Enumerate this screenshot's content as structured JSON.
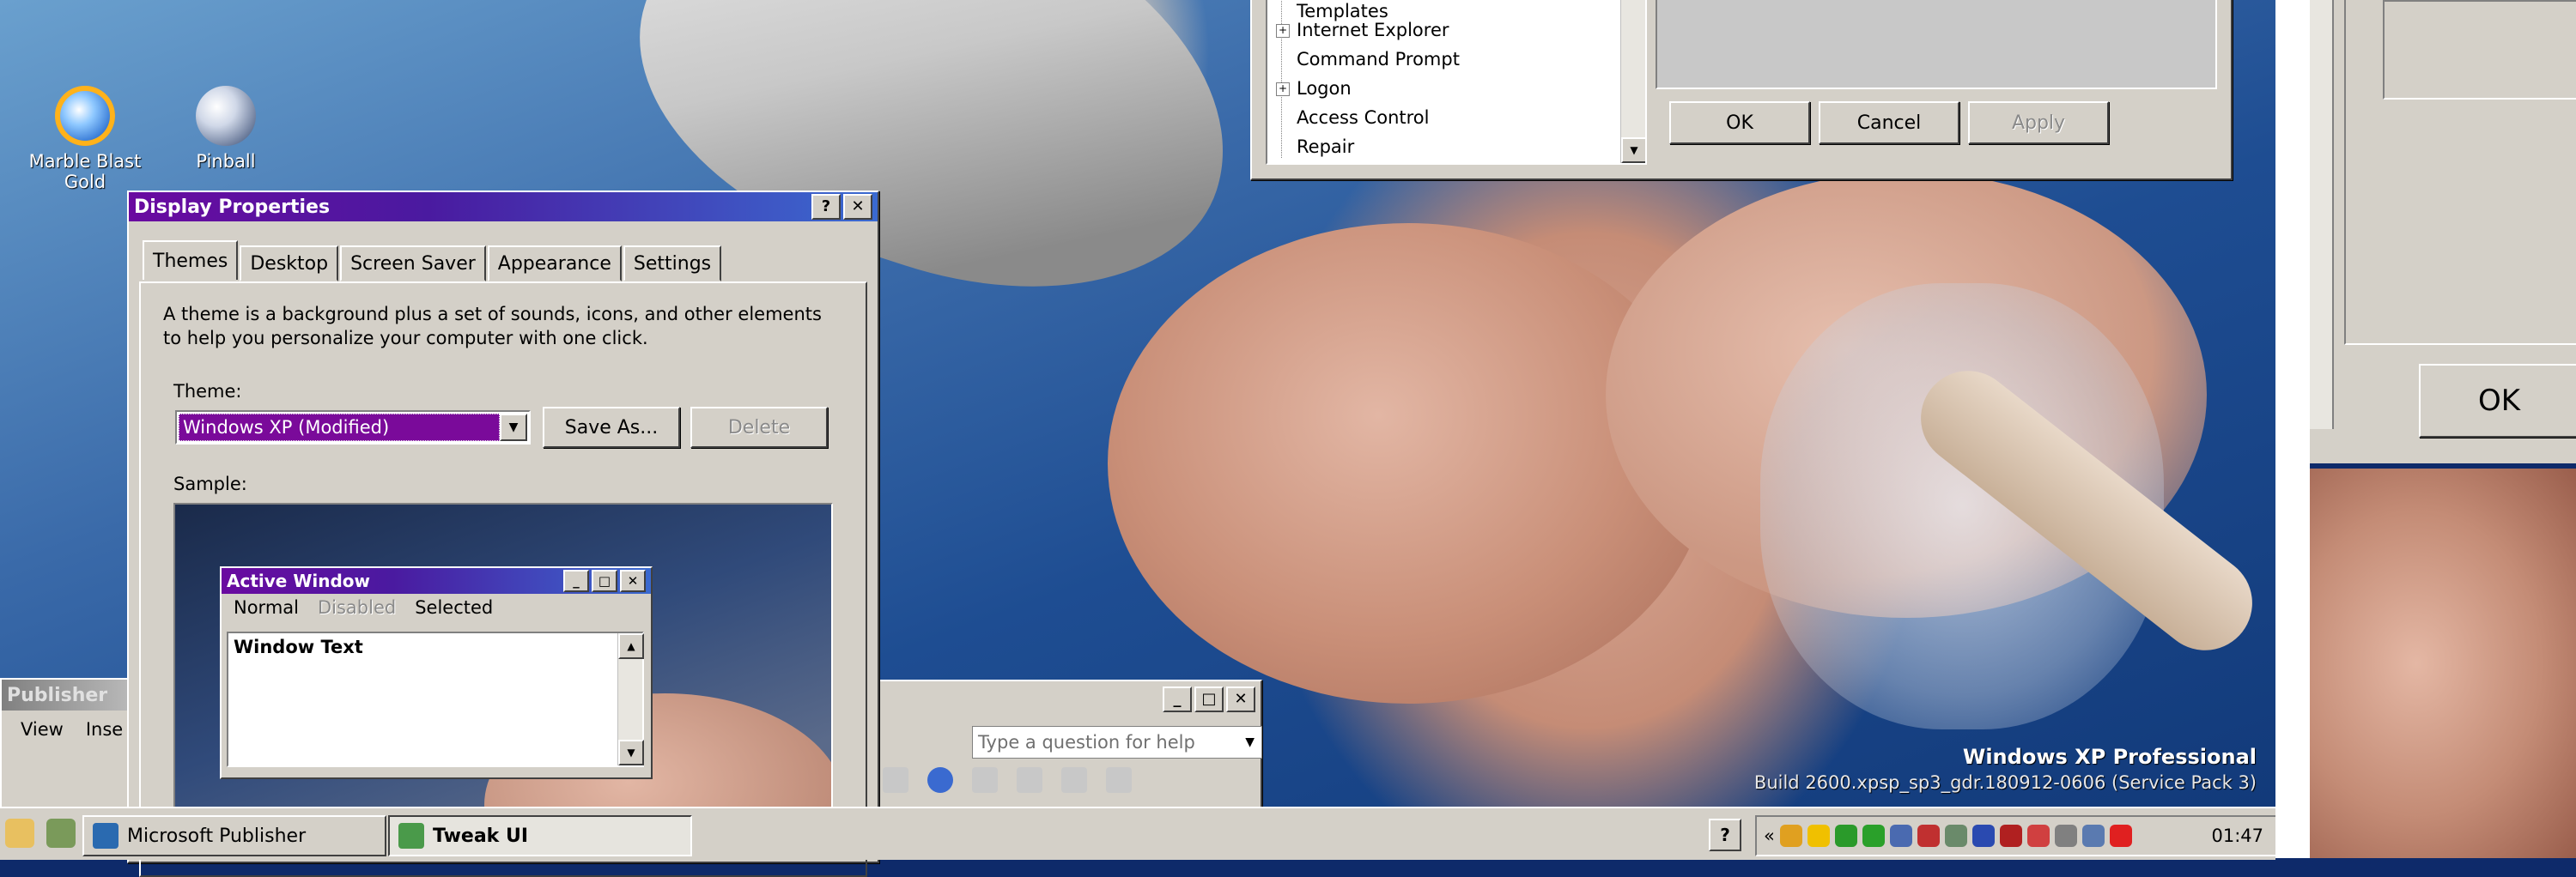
{
  "desktop": {
    "icons": [
      {
        "name": "Marble Blast Gold",
        "line1": "Marble Blast",
        "line2": "Gold"
      },
      {
        "name": "Pinball",
        "line1": "Pinball",
        "line2": ""
      }
    ],
    "watermark": {
      "line1": "Windows XP Professional",
      "line2": "Build 2600.xpsp_sp3_gdr.180912-0606 (Service Pack 3)"
    }
  },
  "display_properties": {
    "title": "Display Properties",
    "help_btn": "?",
    "close_btn": "✕",
    "tabs": [
      "Themes",
      "Desktop",
      "Screen Saver",
      "Appearance",
      "Settings"
    ],
    "active_tab": "Themes",
    "description": "A theme is a background plus a set of sounds, icons, and other elements to help you personalize your computer with one click.",
    "theme_label": "Theme:",
    "theme_value": "Windows XP (Modified)",
    "save_as": "Save As...",
    "delete": "Delete",
    "sample_label": "Sample:",
    "sample_window": {
      "title": "Active Window",
      "menu": [
        "Normal",
        "Disabled",
        "Selected"
      ],
      "text": "Window Text"
    }
  },
  "tweak_ui": {
    "tree_items": [
      {
        "label": "Templates",
        "expandable": false
      },
      {
        "label": "Internet Explorer",
        "expandable": true
      },
      {
        "label": "Command Prompt",
        "expandable": false
      },
      {
        "label": "Logon",
        "expandable": true
      },
      {
        "label": "Access Control",
        "expandable": false
      },
      {
        "label": "Repair",
        "expandable": false
      }
    ],
    "ok": "OK",
    "cancel": "Cancel",
    "apply": "Apply"
  },
  "publisher": {
    "title": "Publisher",
    "menu": [
      "View",
      "Inse"
    ]
  },
  "office_toolbar": {
    "help_placeholder": "Type a question for help"
  },
  "taskbar": {
    "tasks": [
      {
        "label": "Microsoft Publisher",
        "active": false
      },
      {
        "label": "Tweak UI",
        "active": true
      }
    ],
    "help_icon": "?",
    "tray_chevron": "«",
    "clock": "01:47"
  },
  "right_monitor": {
    "ok": "OK"
  },
  "colors": {
    "active_title_start": "#6a0aa0",
    "active_title_end": "#3a6ad0",
    "selection": "#7a0a9a",
    "face": "#d4d0c8"
  }
}
